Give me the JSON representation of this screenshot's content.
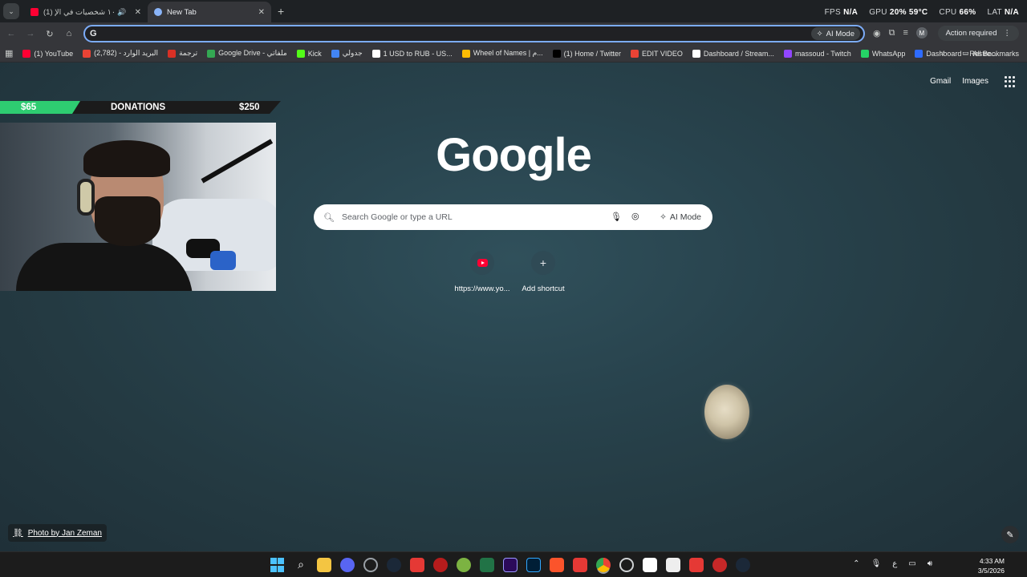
{
  "browser": {
    "tabs": [
      {
        "title": "(1) أغرب ١٠ شخصيات في الإ...",
        "favicon": "youtube-icon",
        "audio": true
      },
      {
        "title": "New Tab",
        "favicon": "chrome-icon",
        "audio": false
      }
    ],
    "toolbar": {
      "omnibox_value": "",
      "ai_mode": "AI Mode",
      "action_required": "Action required",
      "profile_initial": "M"
    },
    "bookmarks": [
      {
        "label": "(1) YouTube",
        "color": "#ff0033"
      },
      {
        "label": "البريد الوارد - (2,782)",
        "color": "#ea4335"
      },
      {
        "label": "ترجمة",
        "color": "#d93025"
      },
      {
        "label": "Google Drive - ملفاتي",
        "color": "#34a853"
      },
      {
        "label": "Kick",
        "color": "#53fc18"
      },
      {
        "label": "جدولي",
        "color": "#4285f4"
      },
      {
        "label": "1 USD to RUB - US...",
        "color": "#ffffff"
      },
      {
        "label": "Wheel of Names | م...",
        "color": "#fbbc04"
      },
      {
        "label": "(1) Home / Twitter",
        "color": "#000000"
      },
      {
        "label": "EDIT VIDEO",
        "color": "#ea4335"
      },
      {
        "label": "Dashboard / Stream...",
        "color": "#ffffff"
      },
      {
        "label": "massoud - Twitch",
        "color": "#9146ff"
      },
      {
        "label": "WhatsApp",
        "color": "#25d366"
      },
      {
        "label": "Dashboard – Restre...",
        "color": "#2e6bff"
      }
    ],
    "all_bookmarks": "All Bookmarks"
  },
  "stats_overlay": {
    "fps_label": "FPS",
    "fps_value": "N/A",
    "gpu_label": "GPU",
    "gpu_value": "20% 59°C",
    "cpu_label": "CPU",
    "cpu_value": "66%",
    "lat_label": "LAT",
    "lat_value": "N/A"
  },
  "newtab": {
    "top_links": [
      "Gmail",
      "Images"
    ],
    "logo": "Google",
    "search_placeholder": "Search Google or type a URL",
    "ai_mode": "AI Mode",
    "shortcuts": [
      {
        "label": "https://www.yo...",
        "icon": "youtube-icon"
      },
      {
        "label": "Add shortcut",
        "icon": "plus-icon"
      }
    ],
    "photo_credit": "Photo by Jan Zeman"
  },
  "donations": {
    "current": "$65",
    "label": "DONATIONS",
    "goal": "$250",
    "progress": 0.26,
    "accent": "#2ecc71"
  },
  "taskbar": {
    "time": "4:33 AM",
    "date": "3/5/2026",
    "lang": "ع"
  }
}
